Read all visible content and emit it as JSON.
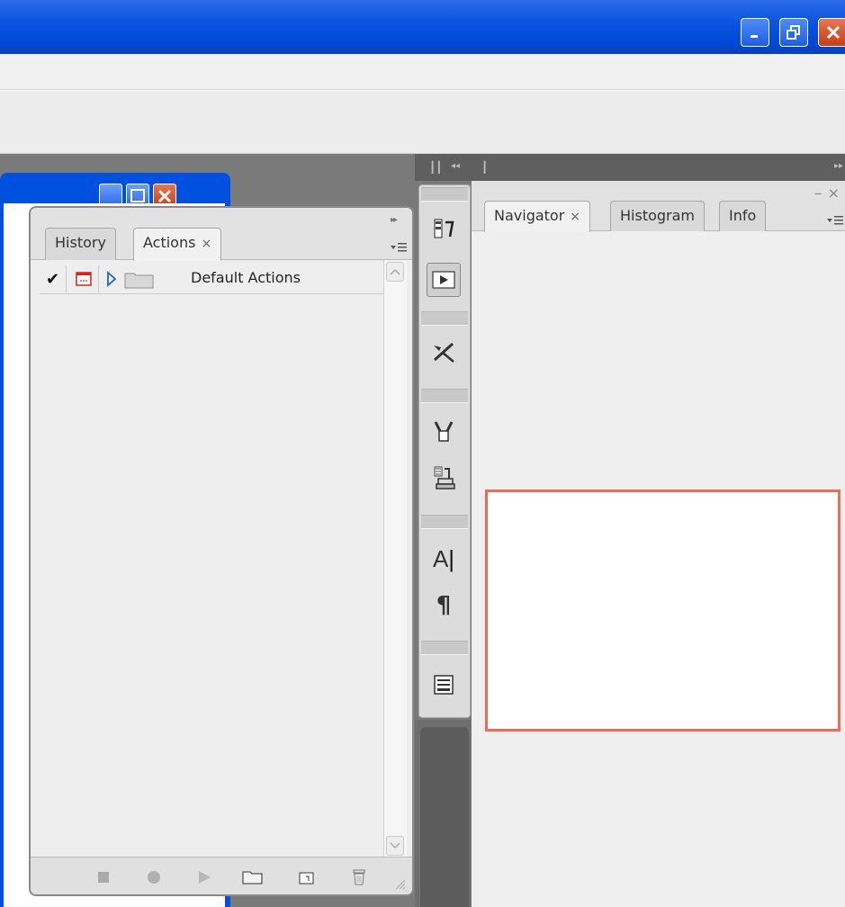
{
  "window": {
    "controls": [
      "minimize-icon",
      "restore-icon",
      "close-icon"
    ],
    "colors": {
      "titlebar": "#0a55e0",
      "close": "#d9471c"
    }
  },
  "actions_panel": {
    "tabs": [
      {
        "label": "History"
      },
      {
        "label": "Actions",
        "close": "×"
      }
    ],
    "rows": [
      {
        "label": "Default Actions"
      }
    ],
    "footer_buttons": [
      "stop-icon",
      "record-icon",
      "play-icon",
      "new-set-icon",
      "new-action-icon",
      "delete-icon"
    ]
  },
  "dock": {
    "icons": [
      "history-icon",
      "actions-icon",
      "tools-icon",
      "brushes-icon",
      "clone-source-icon",
      "character-icon",
      "paragraph-icon",
      "notes-icon"
    ]
  },
  "navigator_panel": {
    "tabs": [
      {
        "label": "Navigator",
        "close": "×"
      },
      {
        "label": "Histogram"
      },
      {
        "label": "Info"
      }
    ],
    "min_label": "–",
    "close_label": "×",
    "preview_border_color": "#ee6a5a"
  },
  "glyphs": {
    "check": "✔",
    "expand": "▶",
    "char": "A",
    "pilcrow": "¶",
    "collapse_left": "◂◂",
    "collapse_right": "▸▸"
  }
}
